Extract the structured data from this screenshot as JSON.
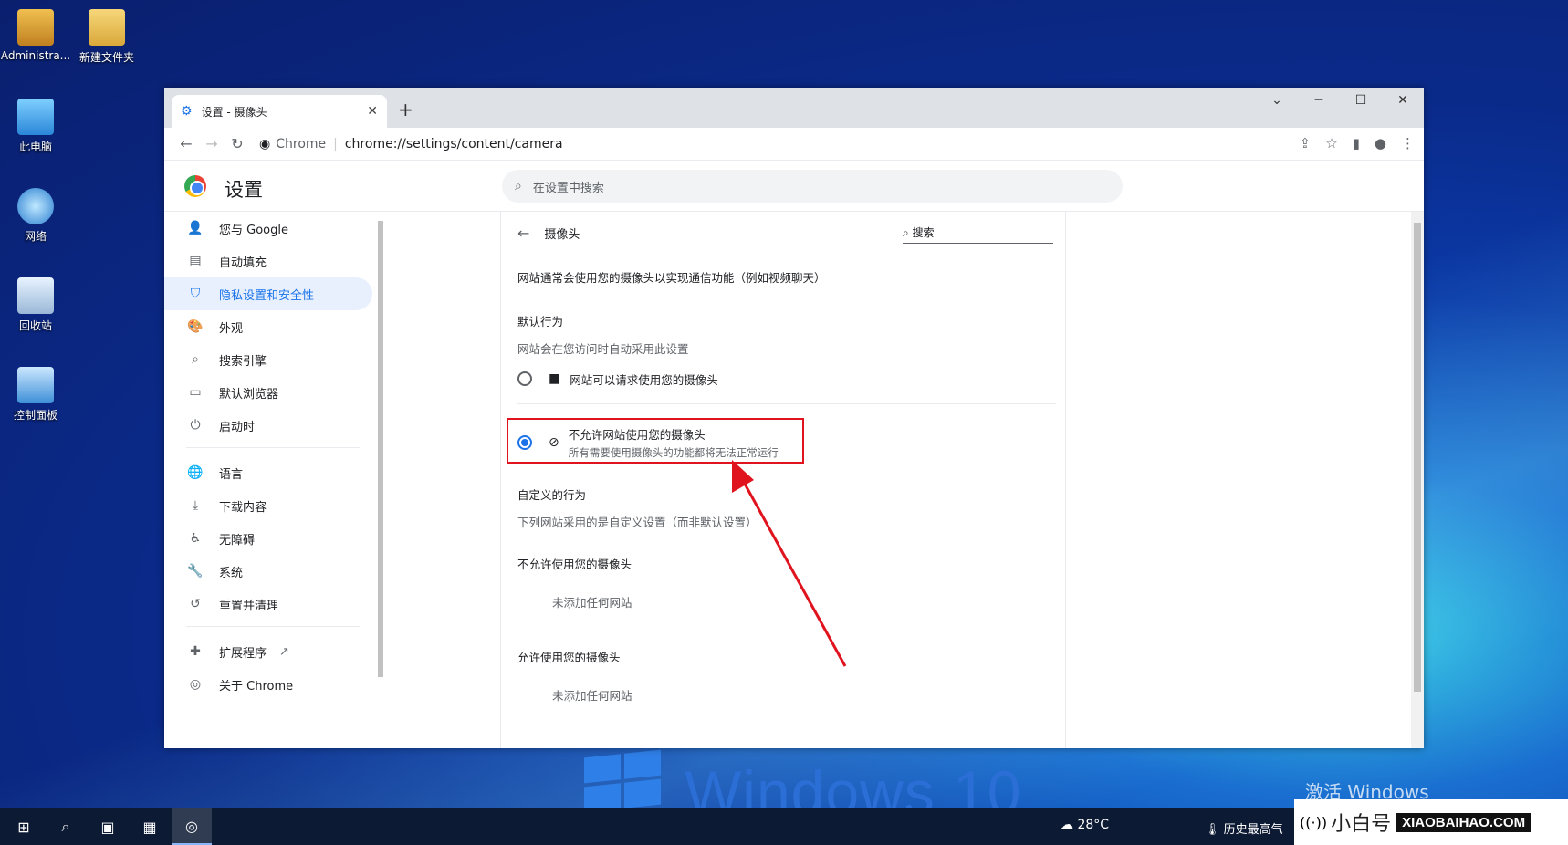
{
  "desktop": {
    "icons": [
      {
        "label": "Administra..."
      },
      {
        "label": "新建文件夹"
      },
      {
        "label": "此电脑"
      },
      {
        "label": "网络"
      },
      {
        "label": "回收站"
      },
      {
        "label": "控制面板"
      }
    ],
    "os_word": "Windows 10",
    "activate_text": "激活 Windows"
  },
  "browser": {
    "tab_title": "设置 - 摄像头",
    "site_chip": "Chrome",
    "url": "chrome://settings/content/camera",
    "settings_title": "设置",
    "search_placeholder": "在设置中搜索"
  },
  "sidebar": {
    "items": [
      {
        "label": "您与 Google"
      },
      {
        "label": "自动填充"
      },
      {
        "label": "隐私设置和安全性"
      },
      {
        "label": "外观"
      },
      {
        "label": "搜索引擎"
      },
      {
        "label": "默认浏览器"
      },
      {
        "label": "启动时"
      },
      {
        "label": "语言"
      },
      {
        "label": "下载内容"
      },
      {
        "label": "无障碍"
      },
      {
        "label": "系统"
      },
      {
        "label": "重置并清理"
      },
      {
        "label": "扩展程序"
      },
      {
        "label": "关于 Chrome"
      }
    ]
  },
  "camera": {
    "header": "摄像头",
    "search_label": "搜索",
    "intro": "网站通常会使用您的摄像头以实现通信功能（例如视频聊天）",
    "default_title": "默认行为",
    "default_sub": "网站会在您访问时自动采用此设置",
    "option_allow": "网站可以请求使用您的摄像头",
    "option_block": "不允许网站使用您的摄像头",
    "option_block_sub": "所有需要使用摄像头的功能都将无法正常运行",
    "custom_title": "自定义的行为",
    "custom_sub": "下列网站采用的是自定义设置（而非默认设置）",
    "blocked_title": "不允许使用您的摄像头",
    "blocked_empty": "未添加任何网站",
    "allowed_title": "允许使用您的摄像头",
    "allowed_empty": "未添加任何网站"
  },
  "taskbar": {
    "weather": "28°C",
    "history_text": "历史最高气",
    "brand_name": "小白号",
    "brand_domain": "XIAOBAIHAO.COM"
  },
  "colors": {
    "accent": "#1a73e8",
    "highlight_box": "#e0141e",
    "arrow": "#e0141e"
  }
}
